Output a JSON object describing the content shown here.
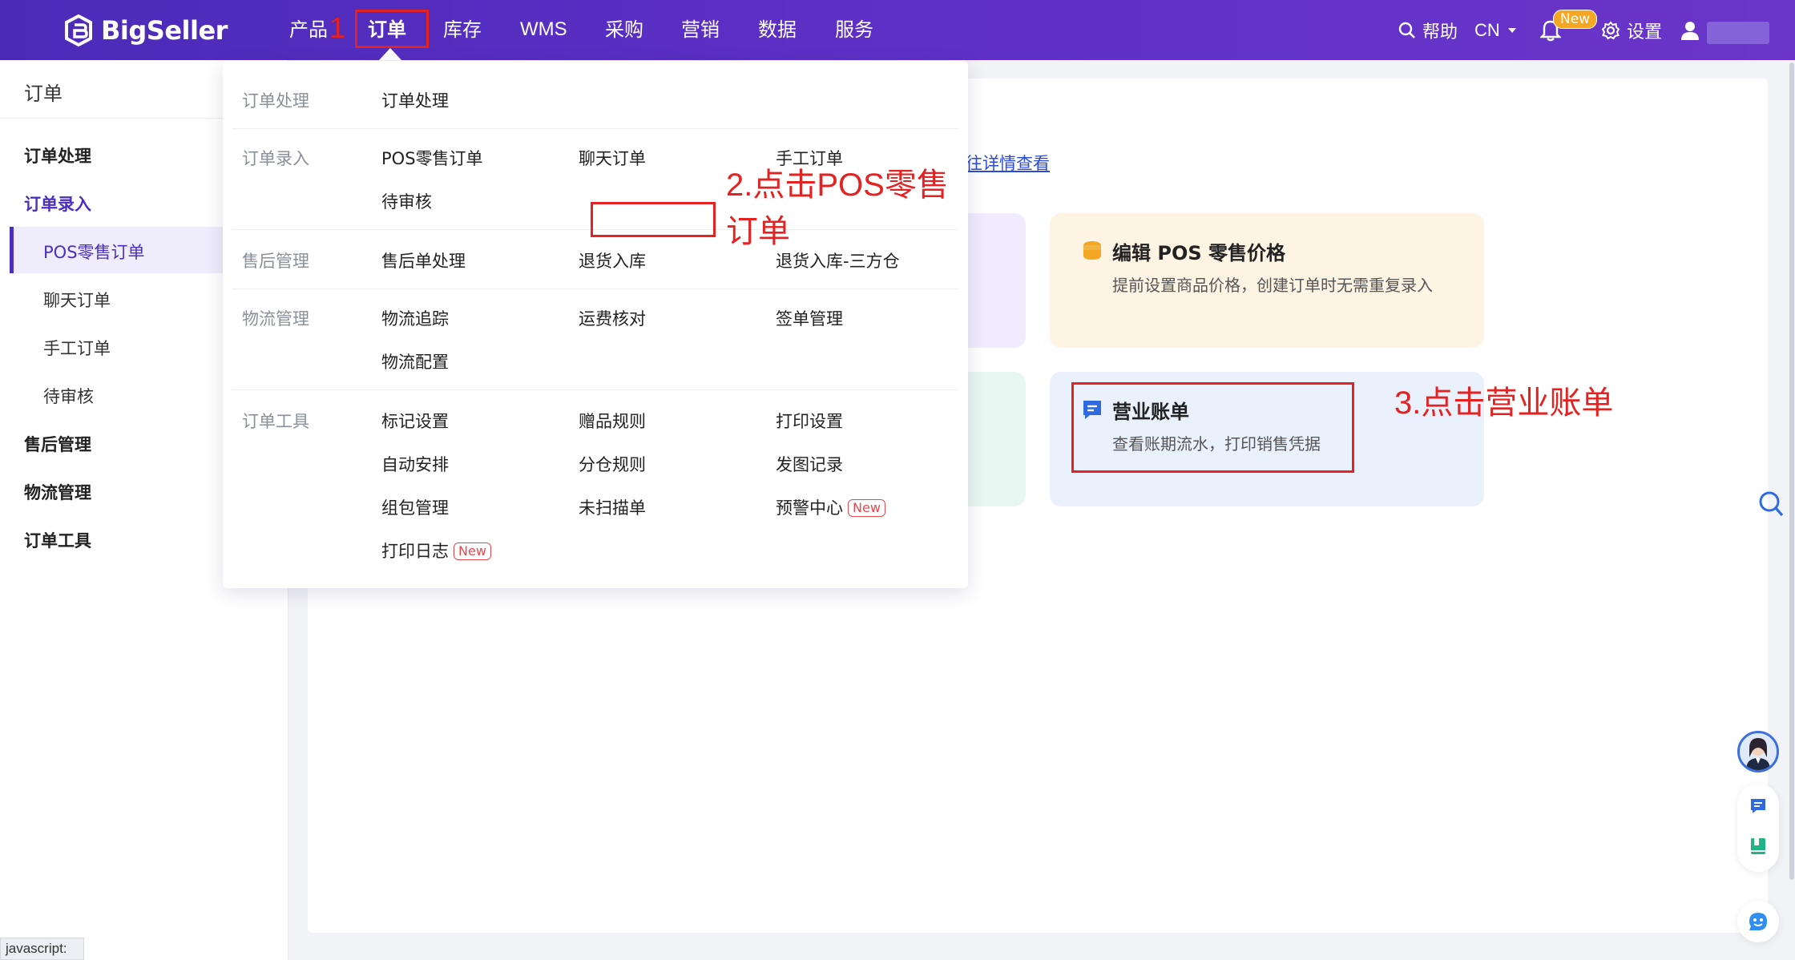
{
  "brand": {
    "name": "BigSeller"
  },
  "nav": {
    "items": [
      "产品",
      "订单",
      "库存",
      "WMS",
      "采购",
      "营销",
      "数据",
      "服务"
    ],
    "help": "帮助",
    "lang": "CN",
    "notif_badge": "New",
    "settings": "设置"
  },
  "annotations": {
    "step1": "1",
    "step2": "2.点击POS零售订单",
    "step3": "3.点击营业账单"
  },
  "sidebar": {
    "title": "订单",
    "items": [
      {
        "label": "订单处理",
        "kind": "group"
      },
      {
        "label": "订单录入",
        "kind": "group-open"
      },
      {
        "label": "POS零售订单",
        "kind": "sub-active"
      },
      {
        "label": "聊天订单",
        "kind": "sub"
      },
      {
        "label": "手工订单",
        "kind": "sub"
      },
      {
        "label": "待审核",
        "kind": "sub"
      },
      {
        "label": "售后管理",
        "kind": "group"
      },
      {
        "label": "物流管理",
        "kind": "group"
      },
      {
        "label": "订单工具",
        "kind": "group"
      }
    ]
  },
  "dropdown": {
    "sections": [
      {
        "label": "订单处理",
        "links": [
          "订单处理"
        ]
      },
      {
        "label": "订单录入",
        "links": [
          "POS零售订单",
          "聊天订单",
          "手工订单",
          "待审核"
        ]
      },
      {
        "label": "售后管理",
        "links": [
          "售后单处理",
          "退货入库",
          "退货入库-三方仓"
        ]
      },
      {
        "label": "物流管理",
        "links": [
          "物流追踪",
          "运费核对",
          "签单管理",
          "物流配置"
        ]
      },
      {
        "label": "订单工具",
        "links": [
          "标记设置",
          "赠品规则",
          "打印设置",
          "自动安排",
          "分仓规则",
          "发图记录",
          "组包管理",
          "未扫描单",
          "预警中心",
          "打印日志"
        ]
      }
    ],
    "new_tag": "New"
  },
  "content": {
    "detail_link": "往详情查看",
    "tiles": [
      {
        "title": "编辑 POS 零售价格",
        "desc": "提前设置商品价格，创建订单时无需重复录入"
      },
      {
        "title": "营业账单",
        "desc": "查看账期流水，打印销售凭据"
      }
    ]
  },
  "status_bar": "javascript:",
  "colors": {
    "brand": "#4b2fbd",
    "annotation": "#e52222",
    "link": "#2b4bd6",
    "tag_new": "#e5484d"
  }
}
